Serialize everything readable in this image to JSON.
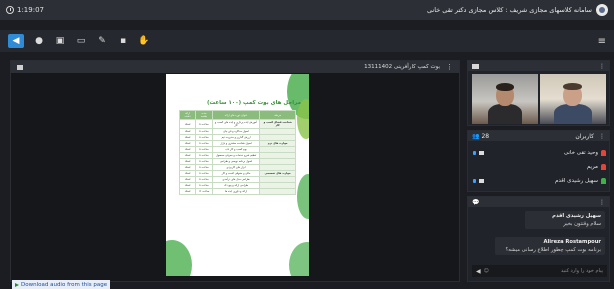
{
  "header": {
    "timer": "1:19:07",
    "title": "سامانه کلاسهای مجازی شریف : کلاس مجازی دکتر تقی خانی"
  },
  "toolbar": {
    "buttons": [
      "speaker-icon",
      "mic-icon",
      "camera-off-icon",
      "share-screen-icon",
      "pointer-icon",
      "layout-icon",
      "raise-hand-icon"
    ],
    "menu": "≡"
  },
  "presentation": {
    "pod_title": "بوت کمپ کارآفرینی 13111402",
    "slide": {
      "title": "مراحل های بوت کمپ (۱۰۰ ساعت)",
      "table_headers": [
        "ارائه دهنده",
        "مدت جلسه",
        "عنوان دوره های ارائه",
        "مرحله"
      ],
      "table_rows": [
        [
          "استاد",
          "۸ ساعت",
          "آموزش ایده پردازی و ایده های کسب و کار",
          "شناخت فضای کسب و کار"
        ],
        [
          "استاد",
          "۸ ساعت",
          "اصول مذاکره و فن بیان",
          ""
        ],
        [
          "استاد",
          "۸ ساعت",
          "ارزش گذاری و مدیریت تیم",
          ""
        ],
        [
          "استاد",
          "۸ ساعت",
          "اصول شناخت مشتری و بازار",
          "مهارت های نرم"
        ],
        [
          "استاد",
          "۸ ساعت",
          "بوم کسب و کار ناب",
          ""
        ],
        [
          "استاد",
          "۸ ساعت",
          "تنظیم شرح خدمات و معرفی محصول",
          ""
        ],
        [
          "استاد",
          "۸ ساعت",
          "اصول برنامه نویسی و طراحی",
          ""
        ],
        [
          "استاد",
          "۸ ساعت",
          "ابزار های کاربردی",
          ""
        ],
        [
          "استاد",
          "۸ ساعت",
          "مالی و حقوقی کسب و کار",
          "مهارت های تخصصی"
        ],
        [
          "استاد",
          "۸ ساعت",
          "طراحی مدل های درآمدی",
          ""
        ],
        [
          "استاد",
          "۸ ساعت",
          "طراحی ارائه و پیچ دک",
          ""
        ],
        [
          "استاد",
          "۱۶ ساعت",
          "ارائه و داوری ایده ها",
          ""
        ]
      ]
    },
    "download_link": "Download audio from this page"
  },
  "attendees": {
    "count": "28",
    "title": "کاربران",
    "list": [
      {
        "name": "وحید تقی خانی",
        "color": "#e2463a"
      },
      {
        "name": "مریم",
        "color": "#e2463a"
      },
      {
        "name": "سهیل رشیدی اقدم",
        "color": "#3fb04a"
      }
    ]
  },
  "chat": {
    "messages": [
      {
        "sender": "سهیل رشیدی اقدم",
        "text": "سلام وقتتون بخیر"
      },
      {
        "sender": "Alireza Rostampour",
        "text": "برنامه بوت کمپ چطور اطلاع رسانی میشه؟"
      }
    ],
    "input_placeholder": "پیام خود را وارد کنید"
  },
  "colors": {
    "accent": "#2f8bd6",
    "slide_green": "#3a8f3a"
  }
}
